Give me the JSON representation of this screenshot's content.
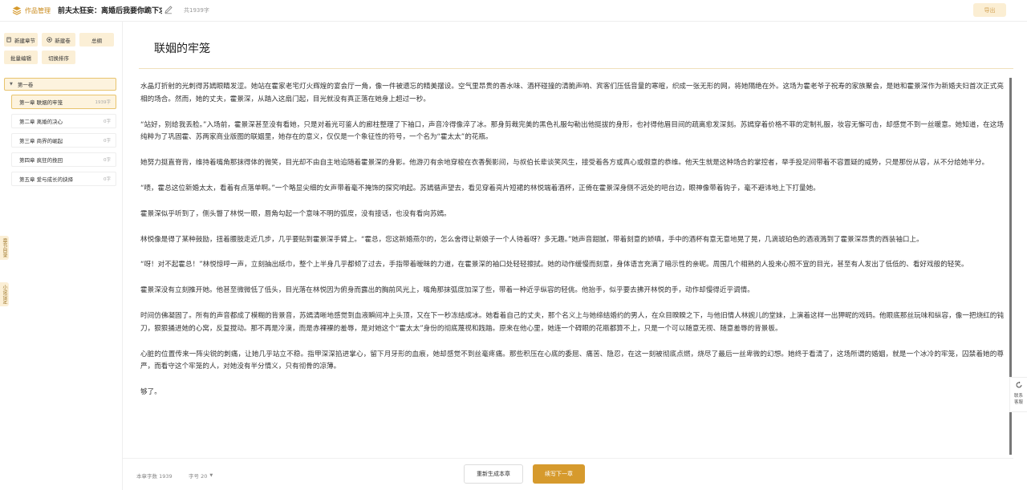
{
  "header": {
    "brand": "作品管理",
    "doc_title": "前夫太狂妄：离婚后我要你跪下求",
    "word_total": "共1939字",
    "export_label": "导出"
  },
  "toolbar": {
    "new_chapter": "新建章节",
    "new_volume": "新建卷",
    "outline": "总纲",
    "batch_edit": "批量编辑",
    "toggle_sort": "切换排序"
  },
  "volume": {
    "name": "第一卷"
  },
  "chapters": [
    {
      "label": "第一章 联姻的牢笼",
      "count": "1939字"
    },
    {
      "label": "第二章 离婚的决心",
      "count": "0字"
    },
    {
      "label": "第三章 商界的崛起",
      "count": "0字"
    },
    {
      "label": "第四章 疯狂的挽回",
      "count": "0字"
    },
    {
      "label": "第五章 爱与成长的抉择",
      "count": "0字"
    }
  ],
  "side_tabs": {
    "chapter_catalog": "章节目录",
    "novel_settings": "小说设定"
  },
  "main": {
    "chapter_title": "联姻的牢笼",
    "paragraphs": [
      "水晶灯折射的光刺得苏嫣眼睛发涩。她站在霍家老宅灯火辉煌的宴会厅一角，像一件被遗忘的精美摆设。空气里昂贵的香水味、酒杯碰撞的清脆声响、宾客们压低音量的寒暄，织成一张无形的网，将她隔绝在外。这场为霍老爷子祝寿的家族聚会，是她和霍景深作为新婚夫妇首次正式亮相的场合。然而，她的丈夫，霍景深，从踏入这扇门起，目光就没有真正落在她身上超过一秒。",
      "“站好，别给我丢脸。”入场前，霍景深甚至没有看她，只是对着光可鉴人的廊柱整理了下袖口，声音冷得像淬了冰。那身剪裁完美的黑色礼服勾勒出他挺拔的身形，也衬得他眉目间的疏离愈发深刻。苏嫣穿着价格不菲的定制礼服，妆容无懈可击，却感觉不到一丝暖意。她知道，在这场纯粹为了巩固霍、苏两家商业版图的联姻里，她存在的意义，仅仅是一个象征性的符号，一个名为“霍太太”的花瓶。",
      "她努力挺直脊背，维持着嘴角那抹得体的微笑，目光却不由自主地追随着霍景深的身影。他游刃有余地穿梭在衣香鬓影间，与叔伯长辈谈笑风生，接受着各方或真心或假意的恭维。他天生就是这种场合的掌控者，举手投足间带着不容置疑的威势，只是那份从容，从不分给她半分。",
      "“啧，霍总这位新婚太太，看着有点落单啊。”一个略显尖细的女声带着毫不掩饰的探究响起。苏嫣循声望去，看见穿着亮片短裙的林悦端着酒杯，正倚在霍景深身侧不远处的吧台边，眼神像带着钩子，毫不避讳地上下打量她。",
      "霍景深似乎听到了，侧头瞥了林悦一眼，唇角勾起一个意味不明的弧度，没有接话，也没有看向苏嫣。",
      "林悦像是得了某种鼓励，扭着腰肢走近几步，几乎要贴到霍景深手臂上。“霍总，您这新婚燕尔的，怎么舍得让新娘子一个人待着呀？多无趣。”她声音甜腻，带着刻意的娇嗔，手中的酒杯有意无意地晃了晃，几滴琥珀色的酒液溅到了霍景深昂贵的西装袖口上。",
      "“呀！对不起霍总！”林悦惊呼一声，立刻抽出纸巾，整个上半身几乎都倾了过去，手指带着暧昧的力道，在霍景深的袖口处轻轻擦拭。她的动作缓慢而刻意，身体语言充满了暗示性的亲昵。周围几个相熟的人投来心照不宣的目光，甚至有人发出了低低的、看好戏般的轻笑。",
      "霍景深没有立刻推开她。他甚至微微低了低头，目光落在林悦因为俯身而露出的胸前风光上，嘴角那抹弧度加深了些，带着一种近乎纵容的轻佻。他抬手，似乎要去拂开林悦的手，动作却慢得近乎调情。",
      "时间仿佛凝固了。所有的声音都成了模糊的背景音，苏嫣清晰地感觉到血液瞬间冲上头顶，又在下一秒冻结成冰。她看着自己的丈夫，那个名义上与她缔结婚约的男人，在众目睽睽之下，与他旧情人林婉儿的堂妹，上演着这样一出狎昵的戏码。他眼底那丝玩味和纵容，像一把烧红的钝刀，狠狠捅进她的心窝，反复搅动。那不再是冷漠，而是赤裸裸的羞辱，是对她这个“霍太太”身份的彻底蔑视和践踏。原来在他心里，她连一个碍眼的花瓶都算不上，只是一个可以随意无视、随意羞辱的背景板。",
      "心脏的位置传来一阵尖锐的刺痛，让她几乎站立不稳。指甲深深掐进掌心，留下月牙形的血痕，她却感觉不到丝毫疼痛。那些积压在心底的委屈、痛苦、隐忍，在这一刻被彻底点燃，烧尽了最后一丝卑微的幻想。她终于看清了，这场所谓的婚姻，就是一个冰冷的牢笼，囚禁着她的尊严，而看守这个牢笼的人，对她没有半分情义，只有彻骨的凉薄。",
      "够了。"
    ]
  },
  "footer": {
    "word_count": "本章字数 1939",
    "font_size": "字号 20",
    "regenerate_label": "重新生成本章",
    "continue_label": "续写下一章"
  },
  "float": {
    "contact": "联系客服"
  },
  "colors": {
    "accent": "#d69a2d",
    "accent_light": "#fbefd6",
    "border_active": "#e8c46e"
  }
}
